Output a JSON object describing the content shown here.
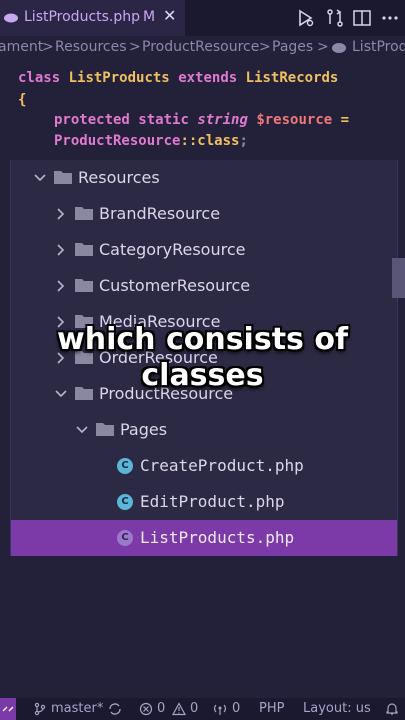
{
  "tab": {
    "filename": "ListProducts.php",
    "modified": "M",
    "close": "✕"
  },
  "breadcrumb": [
    "ament",
    ">",
    "Resources",
    ">",
    "ProductResource",
    ">",
    "Pages",
    ">",
    "ListProdu"
  ],
  "code": {
    "line1": {
      "kw1": "class",
      "name": "ListProducts",
      "kw2": "extends",
      "parent": "ListRecords"
    },
    "line2": "{",
    "line3": {
      "kw1": "protected",
      "kw2": "static",
      "type": "string",
      "var": "$resource",
      "op": "="
    },
    "line4": {
      "cls": "ProductResource",
      "sep": "::",
      "const": "class",
      "end": ";"
    }
  },
  "tree": [
    {
      "label": "Resources",
      "type": "folder",
      "expanded": true
    },
    {
      "label": "BrandResource",
      "type": "folder",
      "expanded": false
    },
    {
      "label": "CategoryResource",
      "type": "folder",
      "expanded": false
    },
    {
      "label": "CustomerResource",
      "type": "folder",
      "expanded": false
    },
    {
      "label": "MediaResource",
      "type": "folder",
      "expanded": false
    },
    {
      "label": "OrderResource",
      "type": "folder",
      "expanded": false
    },
    {
      "label": "ProductResource",
      "type": "folder",
      "expanded": true
    },
    {
      "label": "Pages",
      "type": "folder",
      "expanded": true
    },
    {
      "label": "CreateProduct.php",
      "type": "file"
    },
    {
      "label": "EditProduct.php",
      "type": "file"
    },
    {
      "label": "ListProducts.php",
      "type": "file",
      "selected": true
    }
  ],
  "caption": {
    "line1": "which consists of",
    "line2": "classes"
  },
  "status": {
    "branch": "master*",
    "errors": "0",
    "warnings": "0",
    "ports": "0",
    "language": "PHP",
    "layout": "Layout: us"
  },
  "colors": {
    "accent": "#7b3aa8",
    "tab_text": "#c8a8f0"
  }
}
